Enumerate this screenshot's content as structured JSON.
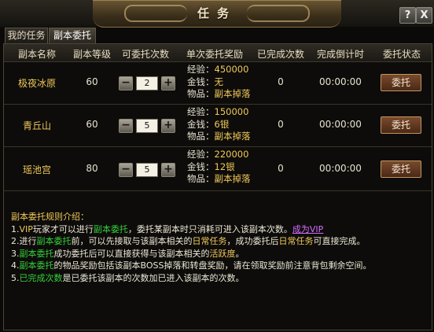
{
  "window": {
    "title": "任务",
    "help_label": "?",
    "close_label": "X"
  },
  "tabs": [
    {
      "label": "我的任务",
      "active": false
    },
    {
      "label": "副本委托",
      "active": true
    }
  ],
  "table": {
    "headers": [
      "副本名称",
      "副本等级",
      "可委托次数",
      "单次委托奖励",
      "已完成次数",
      "完成倒计时",
      "委托状态"
    ],
    "reward_labels": {
      "exp": "经验：",
      "money": "金钱：",
      "item": "物品："
    },
    "rows": [
      {
        "name": "极夜冰原",
        "level": "60",
        "count": "2",
        "minus": "−",
        "plus": "+",
        "exp": "450000",
        "money": "无",
        "item": "副本掉落",
        "done": "0",
        "countdown": "00:00:00",
        "action": "委托"
      },
      {
        "name": "青丘山",
        "level": "60",
        "count": "5",
        "minus": "−",
        "plus": "+",
        "exp": "150000",
        "money": "6银",
        "item": "副本掉落",
        "done": "0",
        "countdown": "00:00:00",
        "action": "委托"
      },
      {
        "name": "瑶池宫",
        "level": "80",
        "count": "5",
        "minus": "−",
        "plus": "+",
        "exp": "220000",
        "money": "12银",
        "item": "副本掉落",
        "done": "0",
        "countdown": "00:00:00",
        "action": "委托"
      }
    ]
  },
  "rules": {
    "title": "副本委托规则介绍：",
    "line1": {
      "a": "1.",
      "b": "VIP",
      "c": "玩家才可以进行",
      "d": "副本委托",
      "e": "，委托某副本时只消耗可进入该副本次数。",
      "f": "成为VIP"
    },
    "line2": {
      "a": "2.进行",
      "b": "副本委托",
      "c": "前，可以先接取与该副本相关的",
      "d": "日常任务",
      "e": "，成功委托后",
      "f": "日常任务",
      "g": "可直接完成。"
    },
    "line3": {
      "a": "3.",
      "b": "副本委托",
      "c": "成功委托后可以直接获得与该副本相关的",
      "d": "活跃度",
      "e": "。"
    },
    "line4": {
      "a": "4.",
      "b": "副本委托",
      "c": "的物品奖励包括该副本BOSS掉落和转盘奖励，请在领取奖励前注意背包剩余空间。"
    },
    "line5": {
      "a": "5.",
      "b": "已完成次数",
      "c": "是已委托该副本的次数加已进入该副本的次数。"
    }
  }
}
